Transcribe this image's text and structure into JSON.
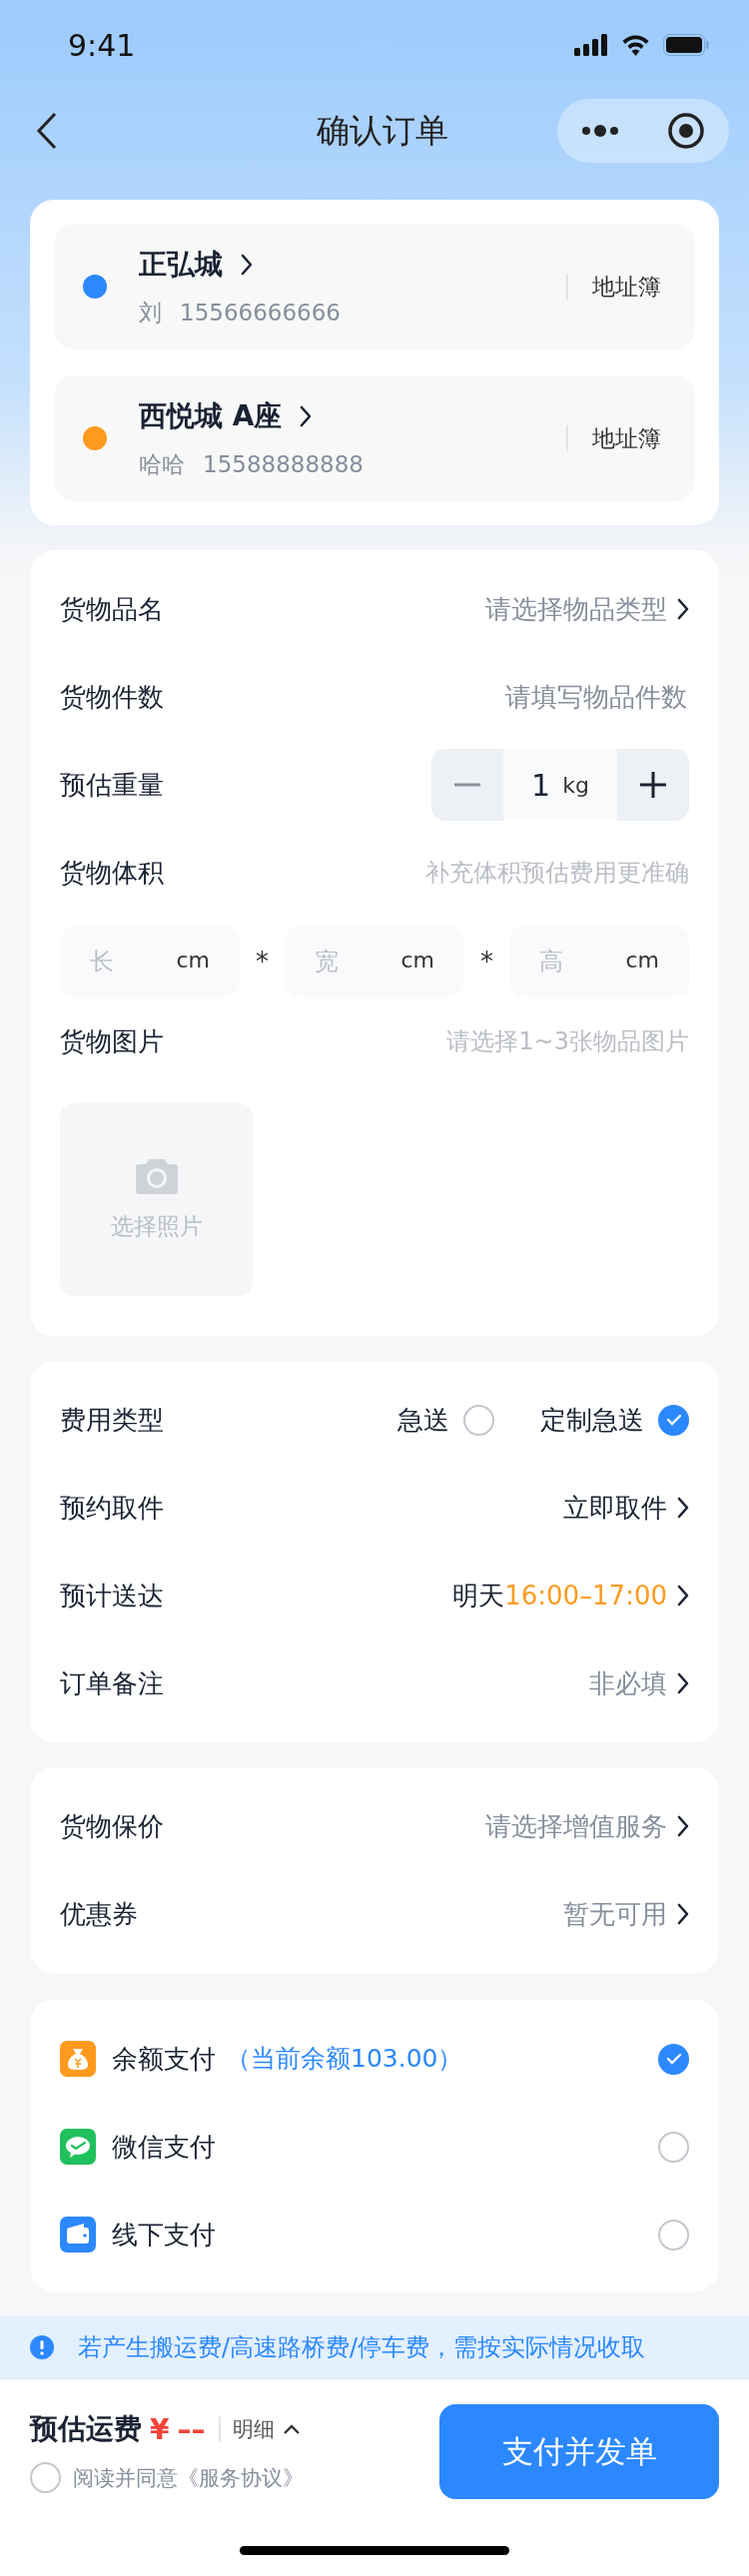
{
  "status_bar": {
    "time": "9:41"
  },
  "nav": {
    "title": "确认订单"
  },
  "addresses": [
    {
      "name": "正弘城",
      "contact": "刘",
      "phone": "15566666666",
      "color": "#2b88ff",
      "link": "地址簿"
    },
    {
      "name": "西悦城 A座",
      "contact": "哈哈",
      "phone": "15588888888",
      "color": "#ff9a1f",
      "link": "地址簿"
    }
  ],
  "cargo": [
    {
      "kind": "select",
      "label": "货物品名",
      "placeholder": "请选择物品类型"
    },
    {
      "kind": "input",
      "label": "货物件数",
      "placeholder": "请填写物品件数"
    },
    {
      "kind": "stepper",
      "label": "预估重量",
      "value": "1",
      "unit": "kg"
    },
    {
      "kind": "hint",
      "label": "货物体积",
      "hint": "补充体积预估费用更准确"
    },
    {
      "kind": "dims",
      "fields": [
        {
          "placeholder": "长",
          "unit": "cm"
        },
        {
          "placeholder": "宽",
          "unit": "cm"
        },
        {
          "placeholder": "高",
          "unit": "cm"
        }
      ],
      "separators": [
        "*",
        "*"
      ]
    },
    {
      "kind": "hint",
      "label": "货物图片",
      "hint": "请选择1~3张物品图片"
    },
    {
      "kind": "photo",
      "label": "选择照片"
    }
  ],
  "delivery": [
    {
      "kind": "choice",
      "label": "费用类型",
      "options": [
        {
          "label": "急送",
          "selected": false
        },
        {
          "label": "定制急送",
          "selected": true
        }
      ]
    },
    {
      "kind": "select",
      "label": "预约取件",
      "value": "立即取件"
    },
    {
      "kind": "select",
      "label": "预计送达",
      "value": "明天",
      "accent": "16:00–17:00"
    },
    {
      "kind": "select",
      "label": "订单备注",
      "placeholder": "非必填"
    }
  ],
  "extras": [
    {
      "kind": "select",
      "label": "货物保价",
      "placeholder": "请选择增值服务"
    },
    {
      "kind": "select",
      "label": "优惠券",
      "placeholder": "暂无可用"
    }
  ],
  "payments": [
    {
      "kind": "balance",
      "label": "余额支付",
      "note": "（当前余额103.00）",
      "selected": true
    },
    {
      "kind": "wechat",
      "label": "微信支付",
      "selected": false
    },
    {
      "kind": "wallet",
      "label": "线下支付",
      "selected": false
    }
  ],
  "notice": "若产生搬运费/高速路桥费/停车费，需按实际情况收取",
  "footer": {
    "label": "预估运费",
    "currency": "¥",
    "amount": "––",
    "detail": "明细",
    "agree": "阅读并同意《服务协议》",
    "agreed": false,
    "button": "支付并发单"
  }
}
